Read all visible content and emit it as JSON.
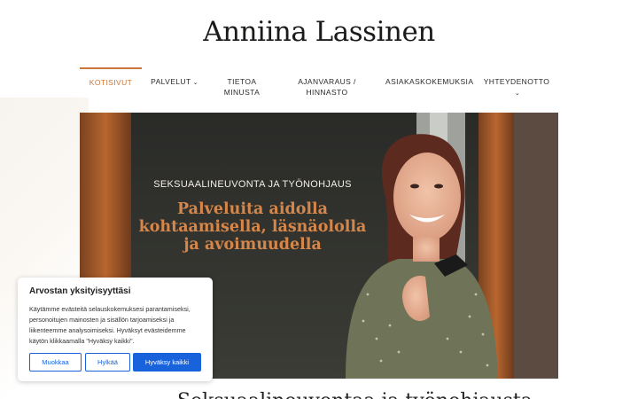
{
  "logo": {
    "text": "Anniina Lassinen"
  },
  "nav": {
    "items": [
      {
        "label": "KOTISIVUT",
        "active": true
      },
      {
        "label": "PALVELUT",
        "dropdown": true
      },
      {
        "label": "TIETOA MINUSTA"
      },
      {
        "label": "AJANVARAUS / HINNASTO"
      },
      {
        "label": "ASIAKASKOKEMUKSIA"
      },
      {
        "label": "YHTEYDENOTTO",
        "dropdown": true
      }
    ]
  },
  "hero": {
    "subtitle": "SEKSUAALINEUVONTA JA TYÖNOHJAUS",
    "title_lines": [
      "Palveluita aidolla",
      "kohtaamisella, läsnäololla",
      "ja avoimuudella"
    ]
  },
  "section": {
    "heading": "Seksuaalineuvontaa ja työnohjausta"
  },
  "cookie": {
    "title": "Arvostan yksityisyyttäsi",
    "text": "Käytämme evästeitä selauskokemuksesi parantamiseksi, personoitujen mainosten ja sisällön tarjoamiseksi ja liikenteemme analysoimiseksi. Hyväksyt evästeidemme käytön klikkaamalla \"Hyväksy kaikki\".",
    "buttons": {
      "customize": "Muokkaa",
      "reject": "Hylkää",
      "accept": "Hyväksy kaikki"
    }
  },
  "colors": {
    "accent": "#c9773a",
    "hero_title": "#d5864a",
    "cookie_button": "#1863dc"
  }
}
